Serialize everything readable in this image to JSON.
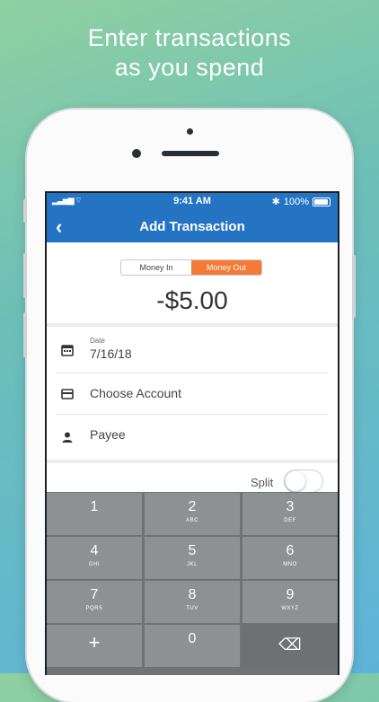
{
  "headline": {
    "line1": "Enter transactions",
    "line2": "as you spend"
  },
  "status": {
    "time": "9:41 AM",
    "battery": "100%"
  },
  "nav": {
    "title": "Add Transaction"
  },
  "toggle": {
    "money_in": "Money In",
    "money_out": "Money Out",
    "selected": "Money Out"
  },
  "amount": "-$5.00",
  "fields": {
    "date_label": "Date",
    "date_value": "7/16/18",
    "account_placeholder": "Choose Account",
    "payee_placeholder": "Payee"
  },
  "split": {
    "label": "Split",
    "on": false
  },
  "keypad": [
    {
      "digit": "1",
      "letters": ""
    },
    {
      "digit": "2",
      "letters": "ABC"
    },
    {
      "digit": "3",
      "letters": "DEF"
    },
    {
      "digit": "4",
      "letters": "GHI"
    },
    {
      "digit": "5",
      "letters": "JKL"
    },
    {
      "digit": "6",
      "letters": "MNO"
    },
    {
      "digit": "7",
      "letters": "PQRS"
    },
    {
      "digit": "8",
      "letters": "TUV"
    },
    {
      "digit": "9",
      "letters": "WXYZ"
    },
    {
      "digit": "+",
      "letters": ""
    },
    {
      "digit": "0",
      "letters": ""
    },
    {
      "digit": "⌫",
      "letters": ""
    }
  ],
  "colors": {
    "brand": "#2574c4",
    "accent": "#f47a36"
  }
}
